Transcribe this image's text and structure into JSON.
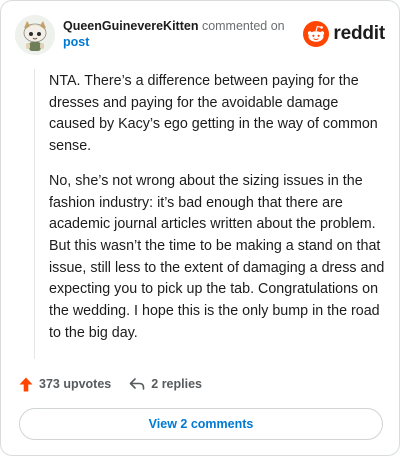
{
  "comment": {
    "author": "QueenGuinevereKitten",
    "action_text": "commented on",
    "target_link": "post",
    "paragraphs": [
      "NTA. There’s a difference between paying for the dresses and paying for the avoidable damage caused by Kacy’s ego getting in the way of common sense.",
      "No, she’s not wrong about the sizing issues in the fashion industry: it’s bad enough that there are academic journal articles written about the problem. But this wasn’t the time to be making a stand on that issue, still less to the extent of damaging a dress and expecting you to pick up the tab. Congratulations on the wedding. I hope this is the only bump in the road to the big day."
    ],
    "upvotes_label": "373 upvotes",
    "replies_label": "2 replies",
    "view_comments_label": "View 2 comments"
  },
  "brand": {
    "name": "reddit",
    "icon": "reddit-snoo-icon",
    "color": "#ff4500"
  },
  "icons": {
    "upvote": "upvote-arrow-icon",
    "reply": "reply-arrow-icon"
  },
  "colors": {
    "link": "#0079d3",
    "upvote": "#ff4500",
    "text": "#1c1c1c",
    "muted": "#6a6e70"
  }
}
